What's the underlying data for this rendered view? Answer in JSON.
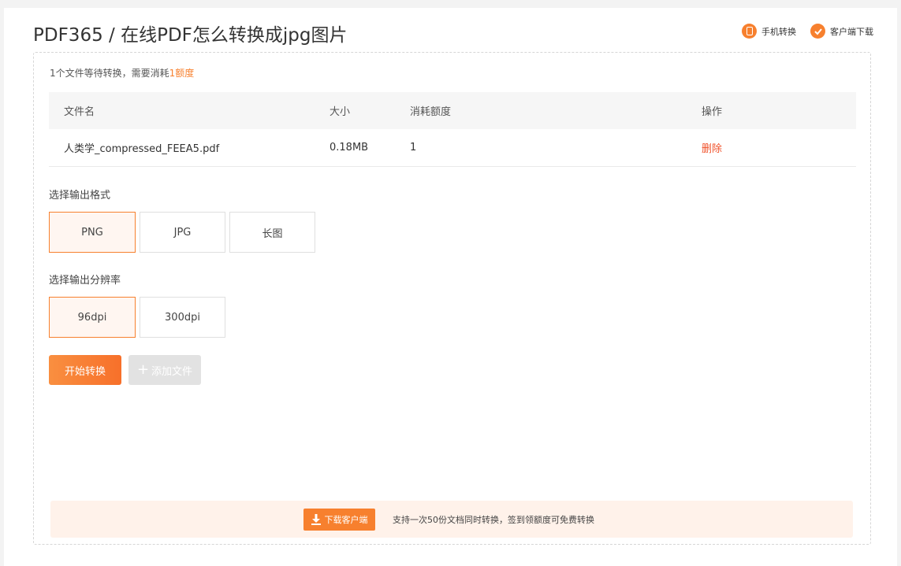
{
  "header": {
    "title": "PDF365 / 在线PDF怎么转换成jpg图片",
    "links": [
      {
        "label": "手机转换",
        "icon": "phone-icon"
      },
      {
        "label": "客户端下载",
        "icon": "download-client-icon"
      }
    ]
  },
  "info": {
    "prefix": "1个文件等待转换，需要消耗",
    "amount": "1额度"
  },
  "table": {
    "headers": [
      "文件名",
      "大小",
      "消耗额度",
      "操作"
    ],
    "rows": [
      {
        "name": "人类学_compressed_FEEA5.pdf",
        "size": "0.18MB",
        "cost": "1",
        "action": "删除"
      }
    ]
  },
  "format": {
    "label": "选择输出格式",
    "options": [
      "PNG",
      "JPG",
      "长图"
    ],
    "selected": "PNG"
  },
  "resolution": {
    "label": "选择输出分辨率",
    "options": [
      "96dpi",
      "300dpi"
    ],
    "selected": "96dpi"
  },
  "buttons": {
    "start": "开始转换",
    "add": "添加文件"
  },
  "banner": {
    "download_label": "下载客户端",
    "text": "支持一次50份文档同时转换，签到领额度可免费转换"
  },
  "colors": {
    "accent": "#f7802e",
    "danger": "#f0522b",
    "selected_bg": "#fff6f1",
    "banner_bg": "#fff2ea"
  }
}
